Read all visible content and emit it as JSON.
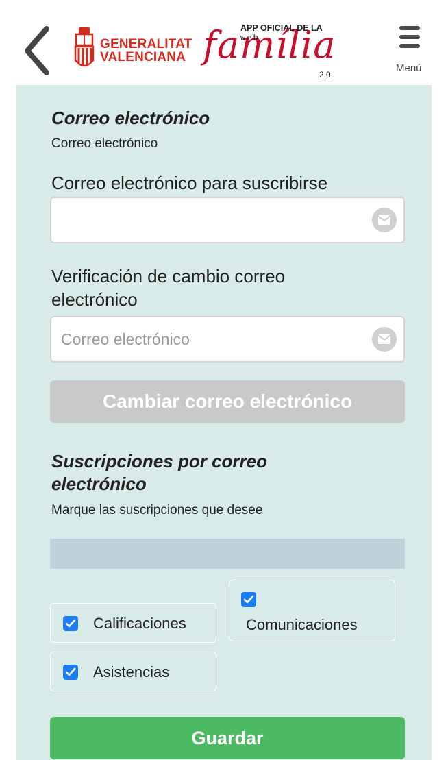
{
  "header": {
    "back_icon": "chevron-left-icon",
    "gv_logo": {
      "line1": "GENERALITAT",
      "line2": "VALENCIANA"
    },
    "familia_logo": {
      "top": "APP OFICIAL DE LA",
      "web": "web",
      "word": "família",
      "version": "2.0"
    },
    "menu_label": "Menú",
    "menu_icon": "hamburger-icon"
  },
  "email_section": {
    "title": "Correo electrónico",
    "subtitle": "Correo electrónico",
    "subscribe_label": "Correo electrónico para suscribirse",
    "subscribe_value": "",
    "subscribe_placeholder": "",
    "verify_label_line1": "Verificación de cambio correo",
    "verify_label_line2": "electrónico",
    "verify_placeholder": "Correo electrónico",
    "change_button": "Cambiar correo electrónico"
  },
  "subscriptions": {
    "title_line1": "Suscripciones por correo",
    "title_line2": "electrónico",
    "subtitle": "Marque las suscripciones que desee",
    "items": [
      {
        "label": "Calificaciones",
        "checked": true
      },
      {
        "label": "Comunicaciones",
        "checked": true
      },
      {
        "label": "Asistencias",
        "checked": true
      }
    ]
  },
  "save_button": "Guardar",
  "colors": {
    "panel_bg": "#d9ebe8",
    "brand_red": "#c8102e",
    "checkbox_blue": "#1e7cf2",
    "save_green": "#4cb963",
    "disabled_gray": "#c9c9c9"
  }
}
